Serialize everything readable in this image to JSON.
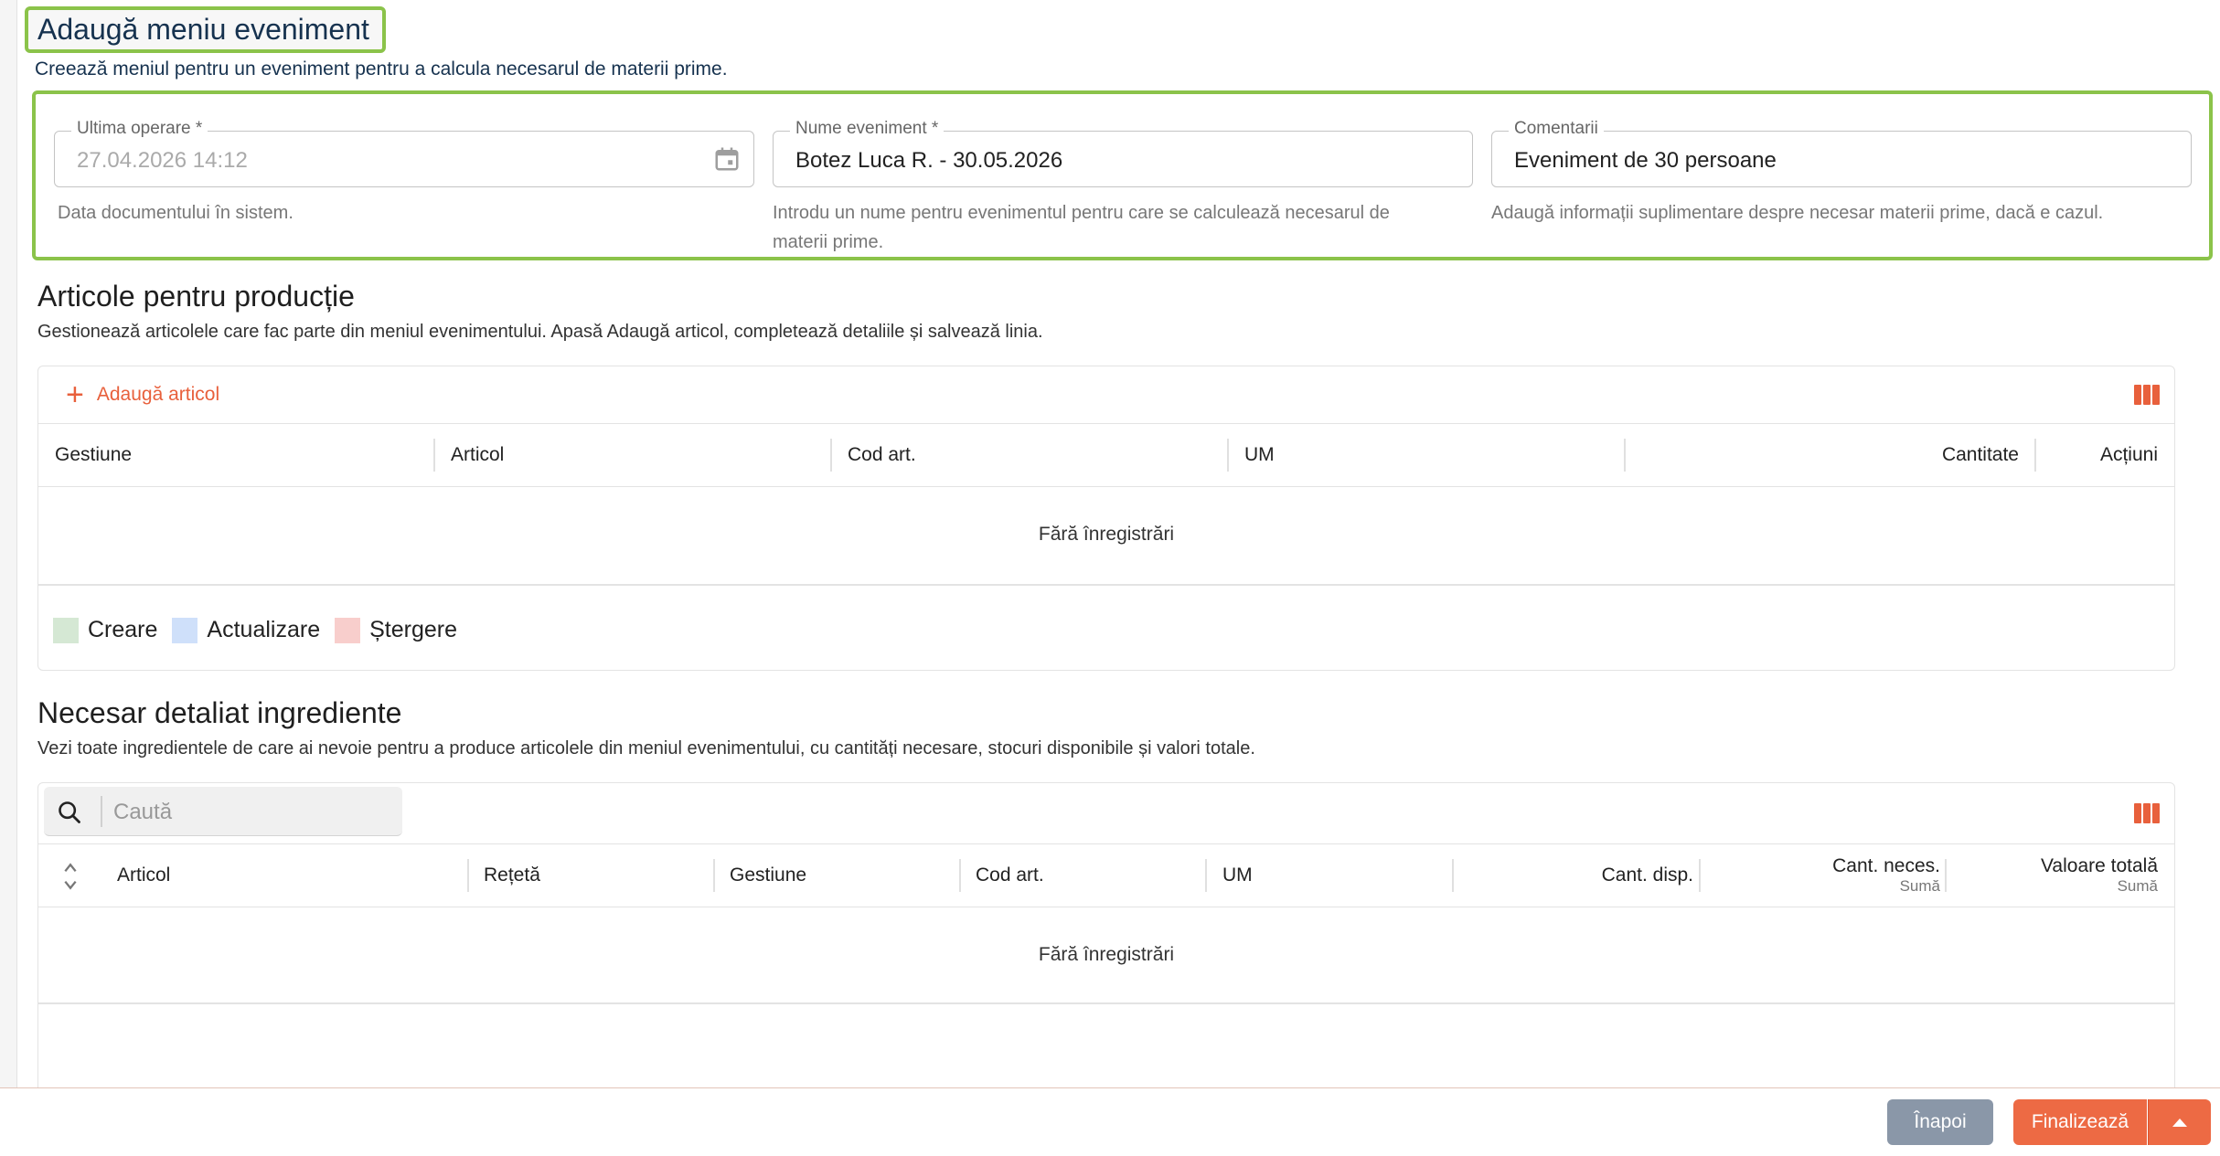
{
  "page": {
    "title": "Adaugă meniu eveniment",
    "subtitle": "Creează meniul pentru un eveniment pentru a calcula necesarul de materii prime."
  },
  "fields": {
    "last_operation": {
      "label": "Ultima operare *",
      "value": "27.04.2026 14:12",
      "help": "Data documentului în sistem."
    },
    "event_name": {
      "label": "Nume eveniment *",
      "value": "Botez Luca R. - 30.05.2026",
      "help_line1": "Introdu un nume pentru evenimentul pentru care se calculează necesarul de",
      "help_line2": "materii prime."
    },
    "comments": {
      "label": "Comentarii",
      "value": "Eveniment de 30 persoane",
      "help": "Adaugă informații suplimentare despre necesar materii prime, dacă e cazul."
    }
  },
  "articles": {
    "title": "Articole pentru producție",
    "description": "Gestionează articolele care fac parte din meniul evenimentului. Apasă Adaugă articol, completează detaliile și salvează linia.",
    "add_label": "Adaugă articol",
    "columns": [
      "Gestiune",
      "Articol",
      "Cod art.",
      "UM",
      "Cantitate",
      "Acțiuni"
    ],
    "empty": "Fără înregistrări",
    "legend": [
      {
        "label": "Creare",
        "color": "#d5e8d4"
      },
      {
        "label": "Actualizare",
        "color": "#cfe0fa"
      },
      {
        "label": "Ștergere",
        "color": "#f8cecc"
      }
    ]
  },
  "ingredients": {
    "title": "Necesar detaliat ingrediente",
    "description": "Vezi toate ingredientele de care ai nevoie pentru a produce articolele din meniul evenimentului, cu cantități necesare, stocuri disponibile și valori totale.",
    "search_placeholder": "Caută",
    "columns": [
      "Articol",
      "Rețetă",
      "Gestiune",
      "Cod art.",
      "UM",
      "Cant. disp.",
      "Cant. neces.",
      "Valoare totală"
    ],
    "column_sub": {
      "cant_neces": "Sumă",
      "valoare_totala": "Sumă"
    },
    "empty": "Fără înregistrări"
  },
  "footer": {
    "back_label": "Înapoi",
    "finish_label": "Finalizează"
  },
  "colors": {
    "accent": "#ed6a44",
    "highlight": "#8bc34a",
    "back_button": "#8a97a8",
    "title": "#16324f"
  }
}
